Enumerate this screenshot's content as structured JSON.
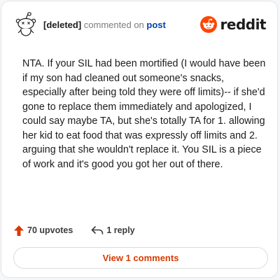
{
  "header": {
    "username": "[deleted]",
    "action_text": "commented on",
    "post_link": "post",
    "brand_name": "reddit",
    "brand_color": "#ff4500"
  },
  "comment": {
    "text": "NTA. If your SIL had been mortified (I would have been if my son had cleaned out someone's snacks, especially after being told they were off limits)-- if she'd gone to replace them immediately and apologized, I could say maybe TA, but she's totally TA for 1. allowing her kid to eat food that was expressly off limits and 2. arguing that she wouldn't replace it. You SIL is a piece of work and it's good you got her out of there."
  },
  "footer": {
    "upvotes_label": "70 upvotes",
    "reply_label": "1 reply",
    "upvote_icon": "upvote-arrow-icon",
    "reply_icon": "reply-arrow-icon"
  },
  "view_comments_label": "View 1 comments",
  "accent_color": "#d93a00"
}
